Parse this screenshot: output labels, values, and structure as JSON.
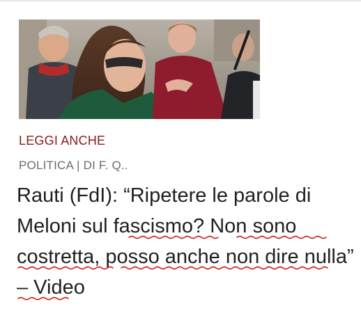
{
  "related": {
    "section_label": "LEGGI ANCHE",
    "meta": "POLITICA | DI F. Q..",
    "headline": "Rauti (FdI): “Ripetere le parole di Meloni sul fascismo? Non sono costretta, posso anche non dire nulla” – Video",
    "thumbnail": "news-photo-thumbnail"
  },
  "colors": {
    "section_label": "#8b1a1a",
    "meta": "#6b6b6b",
    "headline": "#1f1f1f",
    "spellcheck_underline": "#d02020"
  }
}
